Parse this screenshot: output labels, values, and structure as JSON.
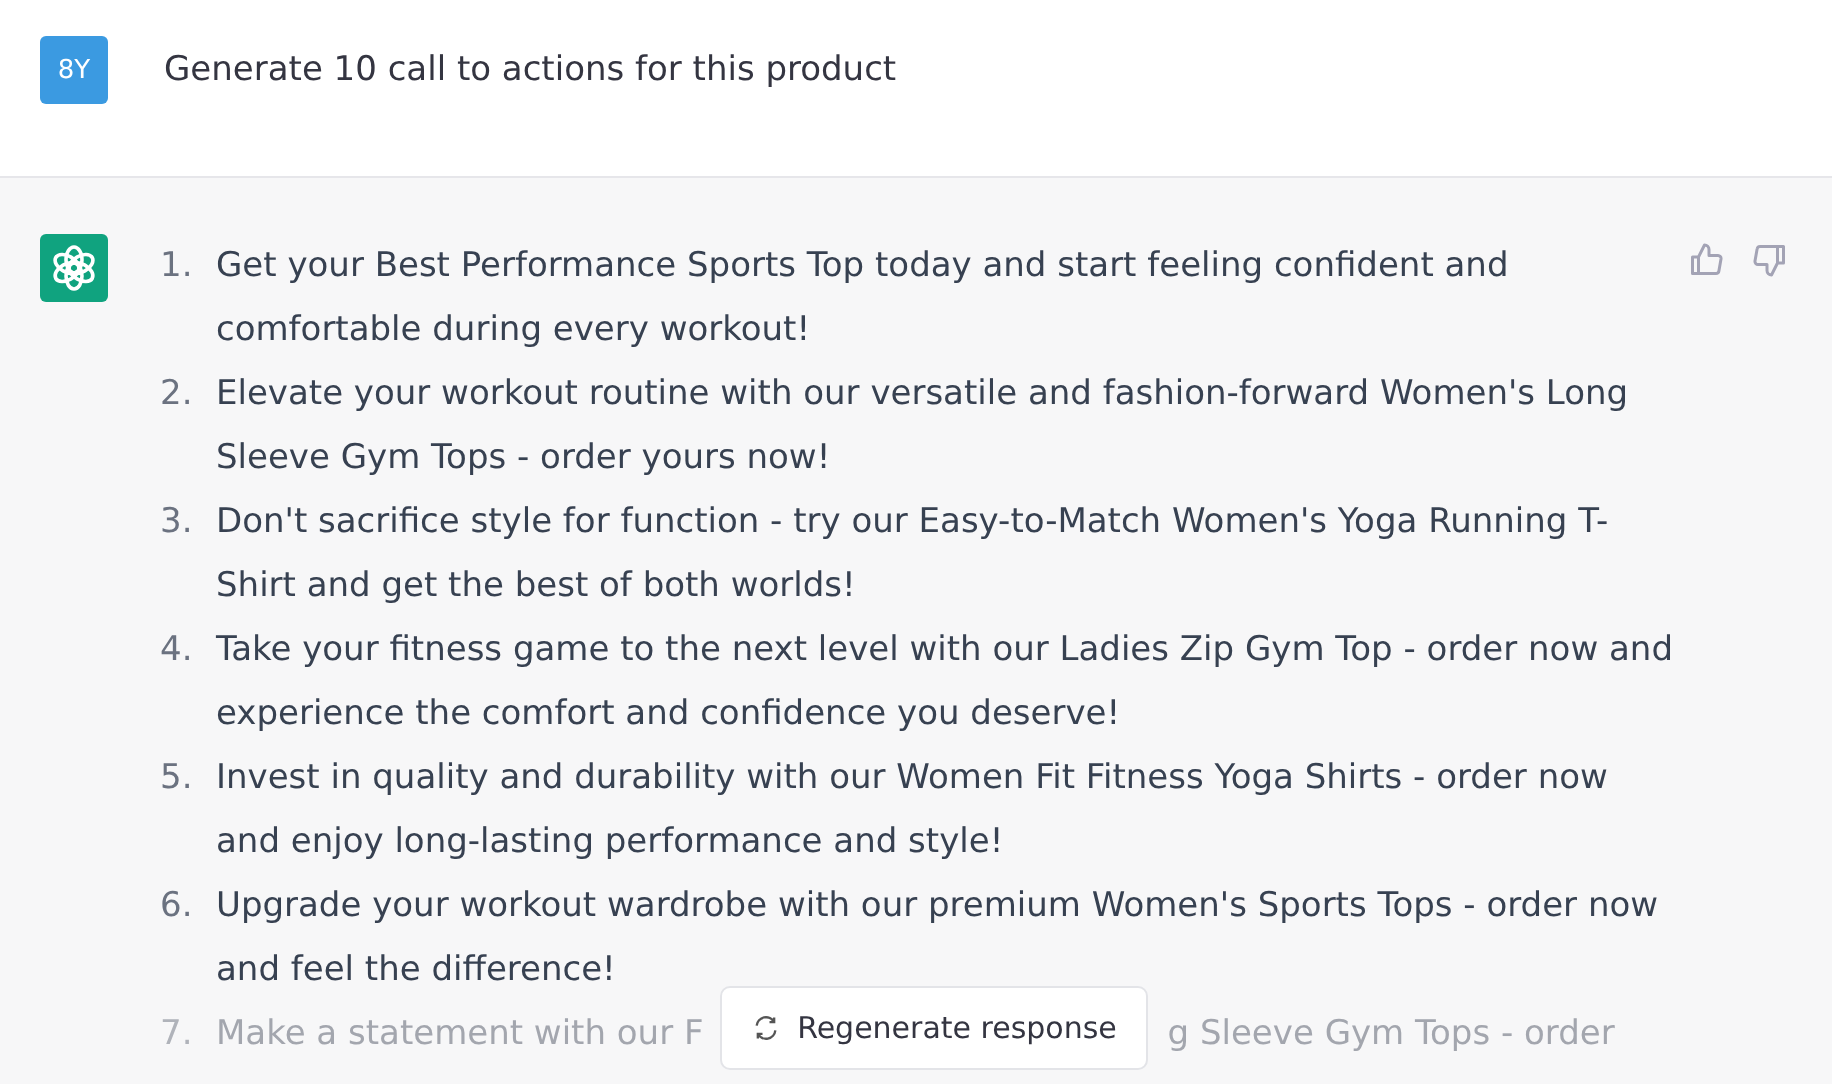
{
  "user_message": {
    "avatar": "8Y",
    "text": "Generate 10 call to actions for this product"
  },
  "response": {
    "items": [
      {
        "number": "1.",
        "text": "Get your Best Performance Sports Top today and start feeling confident and comfortable during every workout!"
      },
      {
        "number": "2.",
        "text": "Elevate your workout routine with our versatile and fashion-forward Women's Long Sleeve Gym Tops - order yours now!"
      },
      {
        "number": "3.",
        "text": "Don't sacrifice style for function - try our Easy-to-Match Women's Yoga Running T-Shirt and get the best of both worlds!"
      },
      {
        "number": "4.",
        "text": "Take your fitness game to the next level with our Ladies Zip Gym Top - order now and experience the comfort and confidence you deserve!"
      },
      {
        "number": "5.",
        "text": "Invest in quality and durability with our Women Fit Fitness Yoga Shirts - order now and enjoy long-lasting performance and style!"
      },
      {
        "number": "6.",
        "text": "Upgrade your workout wardrobe with our premium Women's Sports Tops - order now and feel the difference!"
      }
    ],
    "partial_item": {
      "number": "7.",
      "text_before": "Make a statement with our F",
      "text_after": "g Sleeve Gym Tops - order"
    }
  },
  "regenerate_button": {
    "label": "Regenerate response"
  }
}
